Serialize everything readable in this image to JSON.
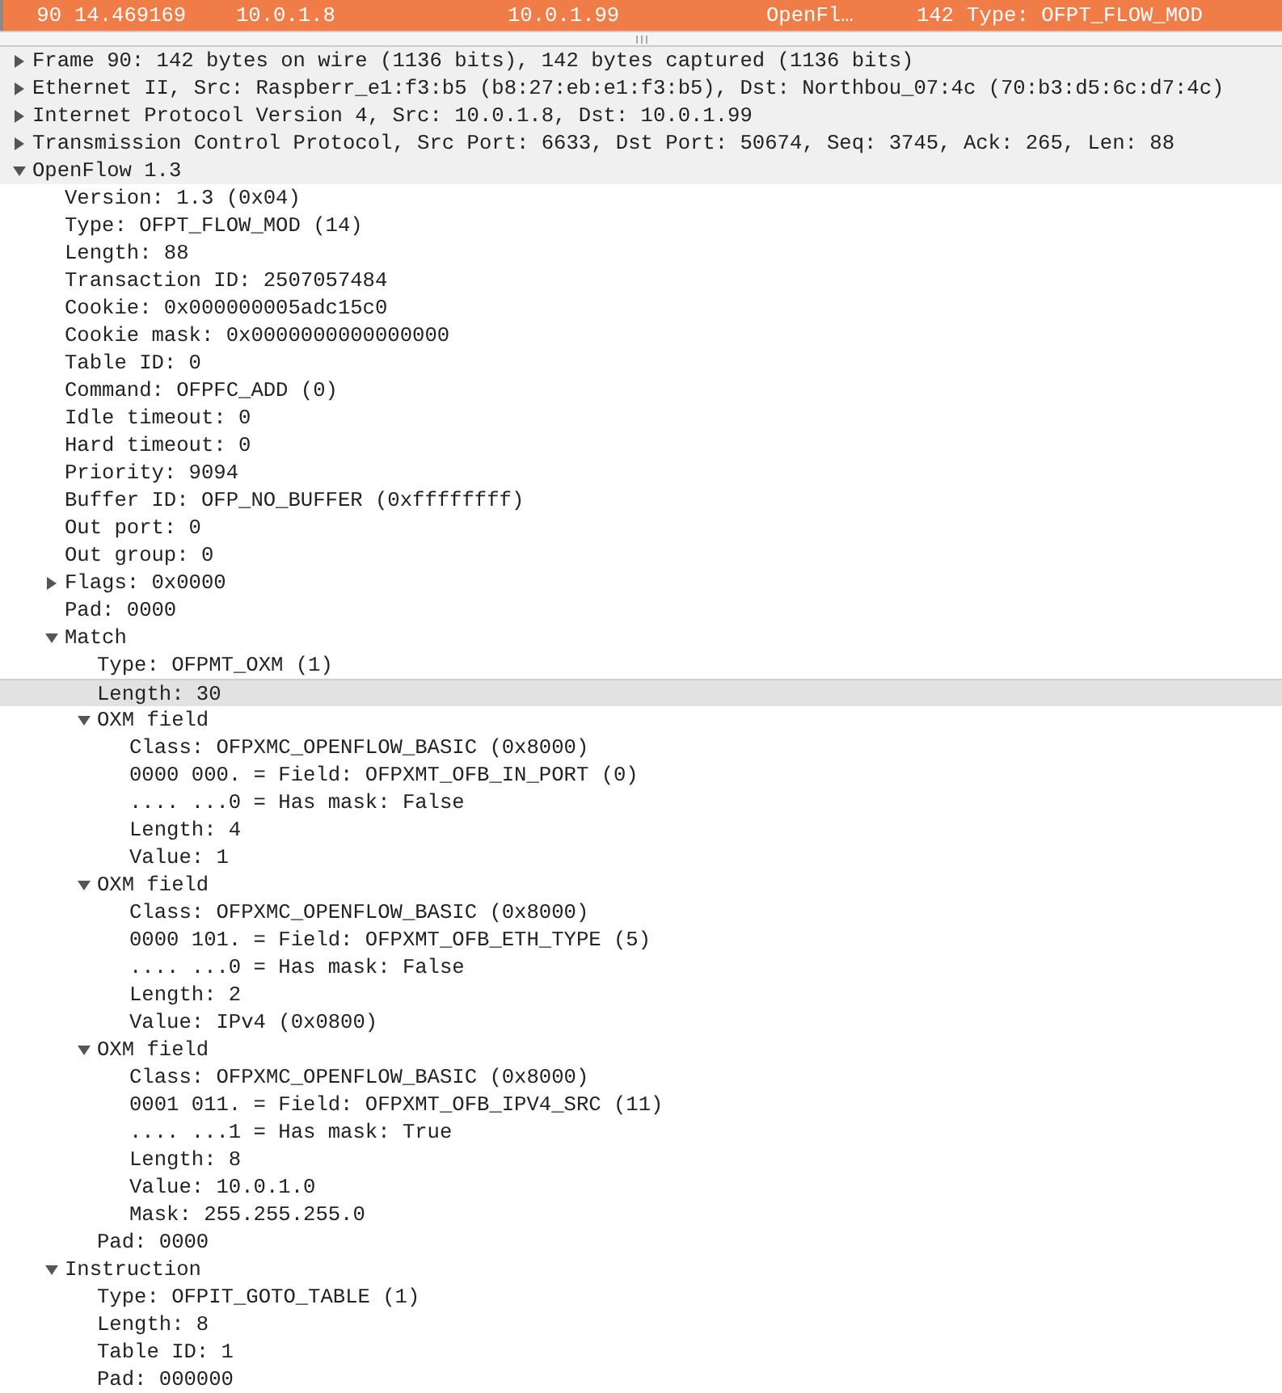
{
  "packet_list": {
    "selected": true,
    "cells": [
      "90",
      "14.469169",
      "10.0.1.8",
      "10.0.1.99",
      "OpenFl…",
      "142",
      "Type: OFPT_FLOW_MOD"
    ]
  },
  "tree": [
    {
      "label": "Frame 90: 142 bytes on wire (1136 bits), 142 bytes captured (1136 bits)",
      "expanded": false,
      "selected": false
    },
    {
      "label": "Ethernet II, Src: Raspberr_e1:f3:b5 (b8:27:eb:e1:f3:b5), Dst: Northbou_07:4c (70:b3:d5:6c:d7:4c)",
      "expanded": false,
      "selected": false
    },
    {
      "label": "Internet Protocol Version 4, Src: 10.0.1.8, Dst: 10.0.1.99",
      "expanded": false,
      "selected": false
    },
    {
      "label": "Transmission Control Protocol, Src Port: 6633, Dst Port: 50674, Seq: 3745, Ack: 265, Len: 88",
      "expanded": false,
      "selected": false
    },
    {
      "label": "OpenFlow 1.3",
      "expanded": true,
      "selected": false,
      "children": [
        {
          "label": "Version: 1.3 (0x04)",
          "selected": false
        },
        {
          "label": "Type: OFPT_FLOW_MOD (14)",
          "selected": false
        },
        {
          "label": "Length: 88",
          "selected": false
        },
        {
          "label": "Transaction ID: 2507057484",
          "selected": false
        },
        {
          "label": "Cookie: 0x000000005adc15c0",
          "selected": false
        },
        {
          "label": "Cookie mask: 0x0000000000000000",
          "selected": false
        },
        {
          "label": "Table ID: 0",
          "selected": false
        },
        {
          "label": "Command: OFPFC_ADD (0)",
          "selected": false
        },
        {
          "label": "Idle timeout: 0",
          "selected": false
        },
        {
          "label": "Hard timeout: 0",
          "selected": false
        },
        {
          "label": "Priority: 9094",
          "selected": false
        },
        {
          "label": "Buffer ID: OFP_NO_BUFFER (0xffffffff)",
          "selected": false
        },
        {
          "label": "Out port: 0",
          "selected": false
        },
        {
          "label": "Out group: 0",
          "selected": false
        },
        {
          "label": "Flags: 0x0000",
          "expanded": false,
          "selected": false
        },
        {
          "label": "Pad: 0000",
          "selected": false
        },
        {
          "label": "Match",
          "expanded": true,
          "selected": false,
          "children": [
            {
              "label": "Type: OFPMT_OXM (1)",
              "selected": false
            },
            {
              "label": "Length: 30",
              "selected": true
            },
            {
              "label": "OXM field",
              "expanded": true,
              "selected": false,
              "children": [
                {
                  "label": "Class: OFPXMC_OPENFLOW_BASIC (0x8000)",
                  "selected": false
                },
                {
                  "label": "0000 000. = Field: OFPXMT_OFB_IN_PORT (0)",
                  "selected": false
                },
                {
                  "label": ".... ...0 = Has mask: False",
                  "selected": false
                },
                {
                  "label": "Length: 4",
                  "selected": false
                },
                {
                  "label": "Value: 1",
                  "selected": false
                }
              ]
            },
            {
              "label": "OXM field",
              "expanded": true,
              "selected": false,
              "children": [
                {
                  "label": "Class: OFPXMC_OPENFLOW_BASIC (0x8000)",
                  "selected": false
                },
                {
                  "label": "0000 101. = Field: OFPXMT_OFB_ETH_TYPE (5)",
                  "selected": false
                },
                {
                  "label": ".... ...0 = Has mask: False",
                  "selected": false
                },
                {
                  "label": "Length: 2",
                  "selected": false
                },
                {
                  "label": "Value: IPv4 (0x0800)",
                  "selected": false
                }
              ]
            },
            {
              "label": "OXM field",
              "expanded": true,
              "selected": false,
              "children": [
                {
                  "label": "Class: OFPXMC_OPENFLOW_BASIC (0x8000)",
                  "selected": false
                },
                {
                  "label": "0001 011. = Field: OFPXMT_OFB_IPV4_SRC (11)",
                  "selected": false
                },
                {
                  "label": ".... ...1 = Has mask: True",
                  "selected": false
                },
                {
                  "label": "Length: 8",
                  "selected": false
                },
                {
                  "label": "Value: 10.0.1.0",
                  "selected": false
                },
                {
                  "label": "Mask: 255.255.255.0",
                  "selected": false
                }
              ]
            },
            {
              "label": "Pad: 0000",
              "selected": false
            }
          ]
        },
        {
          "label": "Instruction",
          "expanded": true,
          "selected": false,
          "children": [
            {
              "label": "Type: OFPIT_GOTO_TABLE (1)",
              "selected": false
            },
            {
              "label": "Length: 8",
              "selected": false
            },
            {
              "label": "Table ID: 1",
              "selected": false
            },
            {
              "label": "Pad: 000000",
              "selected": false
            }
          ]
        }
      ]
    }
  ]
}
